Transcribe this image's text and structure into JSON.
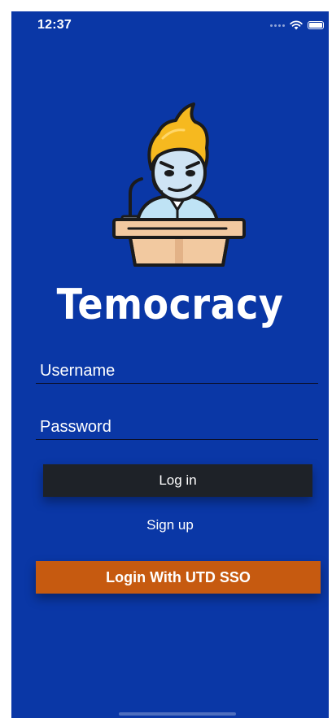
{
  "status_bar": {
    "time": "12:37",
    "icons": [
      "cellular-dots-icon",
      "wifi-icon",
      "battery-icon"
    ]
  },
  "app": {
    "title": "Temocracy",
    "logo_icon": "speaker-at-podium-mascot-icon"
  },
  "form": {
    "username_placeholder": "Username",
    "username_value": "",
    "password_placeholder": "Password",
    "password_value": ""
  },
  "actions": {
    "login_label": "Log in",
    "signup_label": "Sign up",
    "sso_label": "Login With UTD SSO"
  },
  "colors": {
    "background": "#0a37a6",
    "login_button": "#1e2228",
    "sso_button": "#c65a10",
    "text": "#ffffff"
  }
}
